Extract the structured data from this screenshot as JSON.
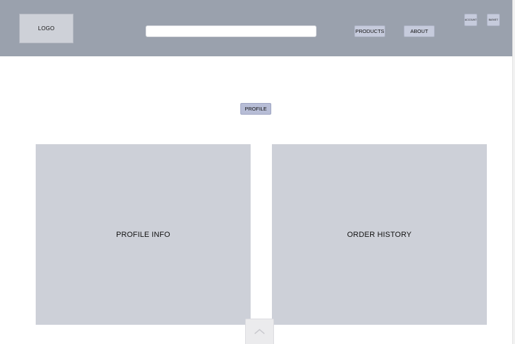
{
  "header": {
    "logo_text": "LOGO",
    "search_value": "",
    "nav": {
      "products": "PRODUCTS",
      "about": "ABOUT"
    },
    "icons": {
      "account": "ACCOUNT",
      "basket": "BASKET"
    }
  },
  "main": {
    "profile_button": "PROFILE",
    "panels": {
      "left": "PROFILE INFO",
      "right": "ORDER HISTORY"
    }
  },
  "footer": {
    "scroll_icon": "chevron-up-icon"
  },
  "colors": {
    "header_bg": "#9aa1ad",
    "logo_bg": "#ced1d8",
    "button_bg": "#c6cbdc",
    "accent_button_bg": "#b7bdd6",
    "panel_bg": "#cdd0d8"
  }
}
